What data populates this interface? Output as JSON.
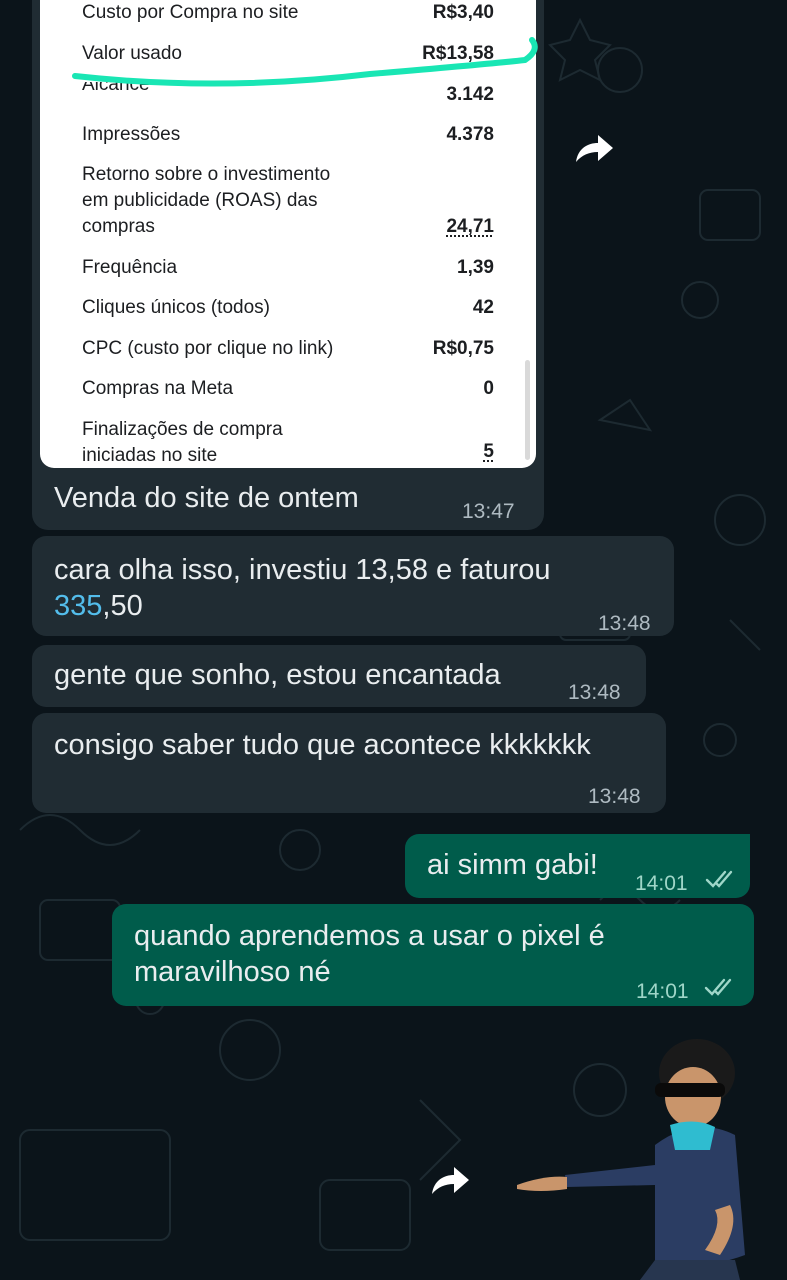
{
  "stats": [
    {
      "label": "Custo por Compra no site",
      "value": "R$3,40"
    },
    {
      "label": "Valor usado",
      "value": "R$13,58"
    },
    {
      "label": "Alcance",
      "value": "3.142"
    },
    {
      "label": "Impressões",
      "value": "4.378"
    },
    {
      "label": "Retorno sobre o investimento em publicidade (ROAS) das compras",
      "value": "24,71"
    },
    {
      "label": "Frequência",
      "value": "1,39"
    },
    {
      "label": "Cliques únicos (todos)",
      "value": "42"
    },
    {
      "label": "CPC (custo por clique no link)",
      "value": "R$0,75"
    },
    {
      "label": "Compras na Meta",
      "value": "0"
    },
    {
      "label": "Finalizações de compra iniciadas no site",
      "value": "5"
    }
  ],
  "stats_lines": {
    "roas_1": "Retorno sobre o investimento",
    "roas_2": "em publicidade (ROAS) das",
    "roas_3": "compras",
    "final_1": "Finalizações de compra",
    "final_2": "iniciadas no site"
  },
  "messages": [
    {
      "text": "Venda do site de ontem",
      "time": "13:47",
      "direction": "incoming"
    },
    {
      "text_part1": "cara olha isso, investiu 13,58 e faturou",
      "link": "335",
      "text_part2": ",50",
      "time": "13:48",
      "direction": "incoming"
    },
    {
      "text": "gente que sonho, estou encantada",
      "time": "13:48",
      "direction": "incoming"
    },
    {
      "text": "consigo saber tudo que acontece kkkkkkk",
      "time": "13:48",
      "direction": "incoming"
    },
    {
      "text": "ai simm gabi!",
      "time": "14:01",
      "direction": "outgoing",
      "status": "read"
    },
    {
      "line1": "quando aprendemos a usar o pixel é",
      "line2": "maravilhoso né",
      "time": "14:01",
      "direction": "outgoing",
      "status": "read"
    }
  ],
  "icons": {
    "forward": "forward-arrow-icon",
    "read": "double-check-icon"
  },
  "colors": {
    "background": "#0b141a",
    "incoming_bubble": "#202c33",
    "outgoing_bubble": "#005c4b",
    "highlight": "#19e6b4",
    "read_check": "#53bdeb"
  }
}
